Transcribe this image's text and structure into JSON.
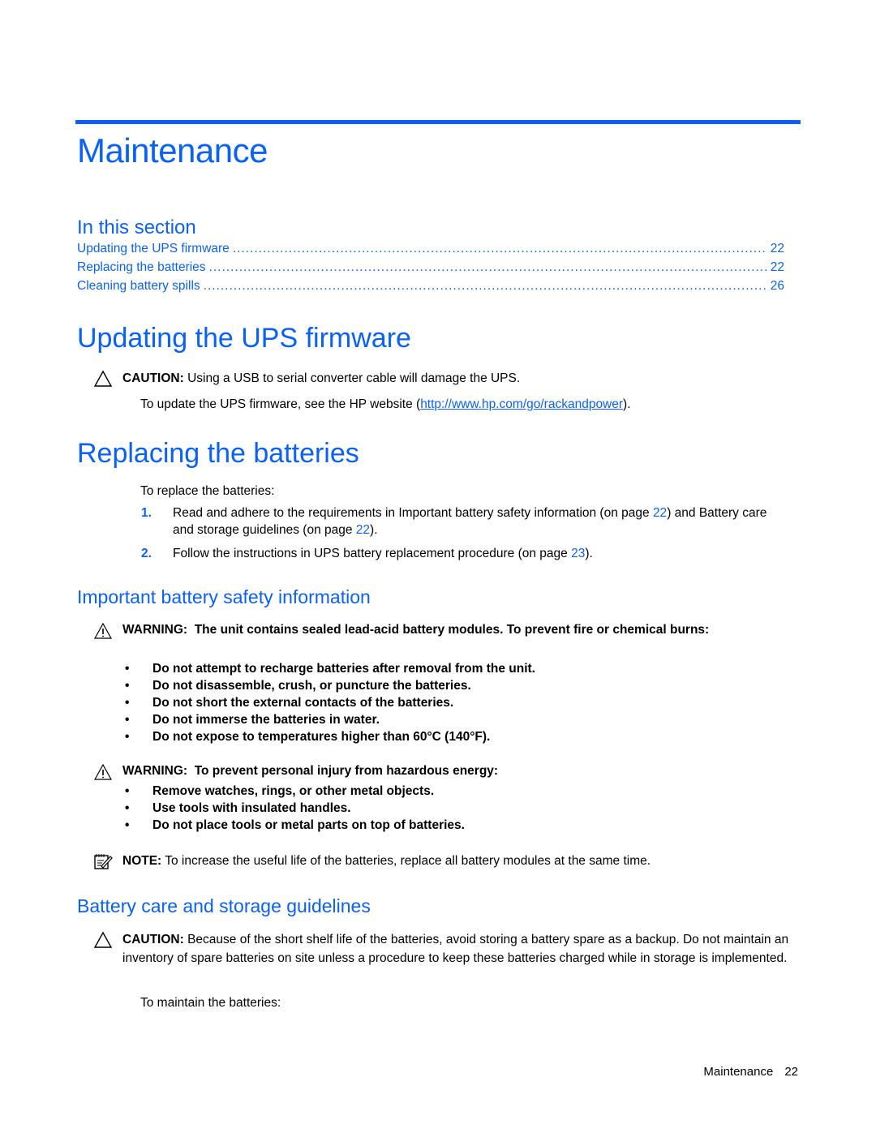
{
  "chapter": {
    "title": "Maintenance"
  },
  "in_this_section": {
    "heading": "In this section",
    "entries": [
      {
        "label": "Updating the UPS firmware",
        "page": "22"
      },
      {
        "label": "Replacing the batteries",
        "page": "22"
      },
      {
        "label": "Cleaning battery spills",
        "page": "26"
      }
    ]
  },
  "firmware": {
    "heading": "Updating the UPS firmware",
    "caution_label": "CAUTION:",
    "caution_text": "Using a USB to serial converter cable will damage the UPS.",
    "body_prefix": "To update the UPS firmware, see the HP website (",
    "link": "http://www.hp.com/go/rackandpower",
    "body_suffix": ")."
  },
  "replacing": {
    "heading": "Replacing the batteries",
    "intro": "To replace the batteries:",
    "steps": [
      {
        "num": "1.",
        "text_a": "Read and adhere to the requirements in Important battery safety information (on page ",
        "page_a": "22",
        "text_b": ") and Battery care and storage guidelines (on page ",
        "page_b": "22",
        "text_c": ")."
      },
      {
        "num": "2.",
        "text_a": "Follow the instructions in UPS battery replacement procedure (on page ",
        "page_a": "23",
        "text_b": ")."
      }
    ]
  },
  "safety": {
    "heading": "Important battery safety information",
    "warning1": {
      "label": "WARNING:",
      "text": "The unit contains sealed lead-acid battery modules. To prevent fire or chemical burns:",
      "bullets": [
        "Do not attempt to recharge batteries after removal from the unit.",
        "Do not disassemble, crush, or puncture the batteries.",
        "Do not short the external contacts of the batteries.",
        "Do not immerse the batteries in water.",
        "Do not expose to temperatures higher than 60°C (140°F)."
      ]
    },
    "warning2": {
      "label": "WARNING:",
      "text": "To prevent personal injury from hazardous energy:",
      "bullets": [
        "Remove watches, rings, or other metal objects.",
        "Use tools with insulated handles.",
        "Do not place tools or metal parts on top of batteries."
      ]
    },
    "note": {
      "label": "NOTE:",
      "text": "To increase the useful life of the batteries, replace all battery modules at the same time."
    }
  },
  "care": {
    "heading": "Battery care and storage guidelines",
    "caution_label": "CAUTION:",
    "caution_text": "Because of the short shelf life of the batteries, avoid storing a battery spare as a backup. Do not maintain an inventory of spare batteries on site unless a procedure to keep these batteries charged while in storage is implemented.",
    "intro": "To maintain the batteries:"
  },
  "footer": {
    "section": "Maintenance",
    "page": "22"
  },
  "colors": {
    "accent": "#0a62f5"
  }
}
